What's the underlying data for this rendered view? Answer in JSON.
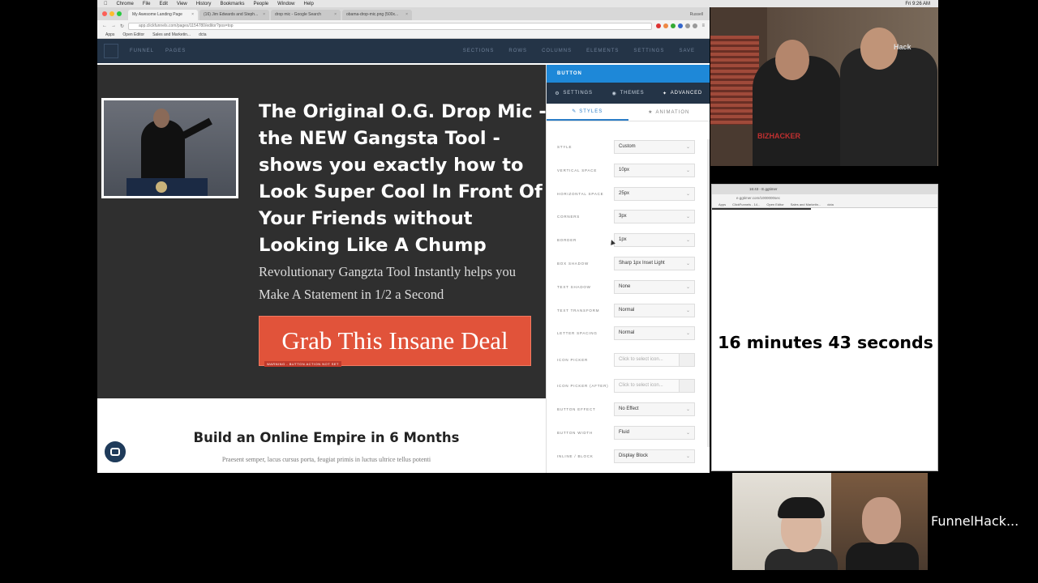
{
  "mac_menubar": {
    "items": [
      "Chrome",
      "File",
      "Edit",
      "View",
      "History",
      "Bookmarks",
      "People",
      "Window",
      "Help"
    ],
    "clock": "Fri 9:26 AM"
  },
  "browser": {
    "tabs": [
      {
        "label": "My Awesome Landing Page"
      },
      {
        "label": "(16) Jim Edwards and Steph..."
      },
      {
        "label": "drop mic - Google Search"
      },
      {
        "label": "obama-drop-mic.png (500x..."
      }
    ],
    "profile": "Russell",
    "url": "app.clickfunnels.com/pages/1154780/editor?pos=top",
    "bookmarks": [
      "Apps",
      "Open Editor",
      "Sales and Marketin...",
      "dcta"
    ]
  },
  "editor": {
    "toolbar_left": [
      "FUNNEL",
      "PAGES"
    ],
    "toolbar_right": [
      "SECTIONS",
      "ROWS",
      "COLUMNS",
      "ELEMENTS",
      "SETTINGS",
      "SAVE"
    ]
  },
  "page": {
    "hero_title": "The Original O.G. Drop Mic - the NEW Gangsta Tool - shows you exactly how to Look Super Cool In Front Of Your Friends without Looking Like A Chump",
    "hero_subtitle": "Revolutionary Gangzta Tool Instantly helps you Make A Statement in 1/2 a Second",
    "cta_label": "Grab This Insane Deal",
    "cta_tag": "WARNING - BUTTON ACTION NOT SET",
    "section2_title": "Build an Online Empire in 6 Months",
    "section2_subtitle": "Praesent semper, lacus cursus porta, feugiat primis in luctus ultrice tellus potenti"
  },
  "panel": {
    "header": "BUTTON",
    "tabs": [
      {
        "label": "SETTINGS",
        "icon": "gear-icon"
      },
      {
        "label": "THEMES",
        "icon": "palette-icon"
      },
      {
        "label": "ADVANCED",
        "icon": "wrench-icon"
      }
    ],
    "sub_tabs": [
      {
        "label": "STYLES",
        "icon": "brush-icon"
      },
      {
        "label": "ANIMATION",
        "icon": "star-icon"
      }
    ],
    "rows": [
      {
        "label": "Style",
        "value": "Custom"
      },
      {
        "label": "Vertical Space",
        "value": "10px"
      },
      {
        "label": "Horizontal Space",
        "value": "25px"
      },
      {
        "label": "Corners",
        "value": "3px"
      },
      {
        "label": "Border",
        "value": "1px"
      },
      {
        "label": "Box Shadow",
        "value": "Sharp 1px Inset Light"
      },
      {
        "label": "Text Shadow",
        "value": "None"
      },
      {
        "label": "Text Transform",
        "value": "Normal"
      },
      {
        "label": "Letter Spacing",
        "value": "Normal"
      },
      {
        "label": "Icon Picker",
        "placeholder": "Click to select icon..."
      },
      {
        "label": "Icon Picker (After)",
        "placeholder": "Click to select icon..."
      },
      {
        "label": "Button Effect",
        "value": "No Effect"
      },
      {
        "label": "Button Width",
        "value": "Fluid"
      },
      {
        "label": "Inline / Block",
        "value": "Display Block"
      }
    ]
  },
  "timer": {
    "tab": "16:43 - E.ggtimer",
    "url": "e.ggtimer.com/1000000sec",
    "bookmarks": [
      "Apps",
      "ClickFunnels - 14...",
      "Open Editor",
      "Sales and Marketin...",
      "dcta"
    ],
    "progress": 0.44,
    "readout": "16 minutes 43 seconds"
  },
  "cam1": {
    "shirt_text": "BIZHACKER",
    "shirt_text_2": "Hack"
  },
  "cam2": {
    "label": "FunnelHack..."
  },
  "colors": {
    "panel_blue": "#1e88d8",
    "editor_navy": "#243447",
    "cta_orange": "#e1533a",
    "hero_bg": "#2f2f2f"
  }
}
